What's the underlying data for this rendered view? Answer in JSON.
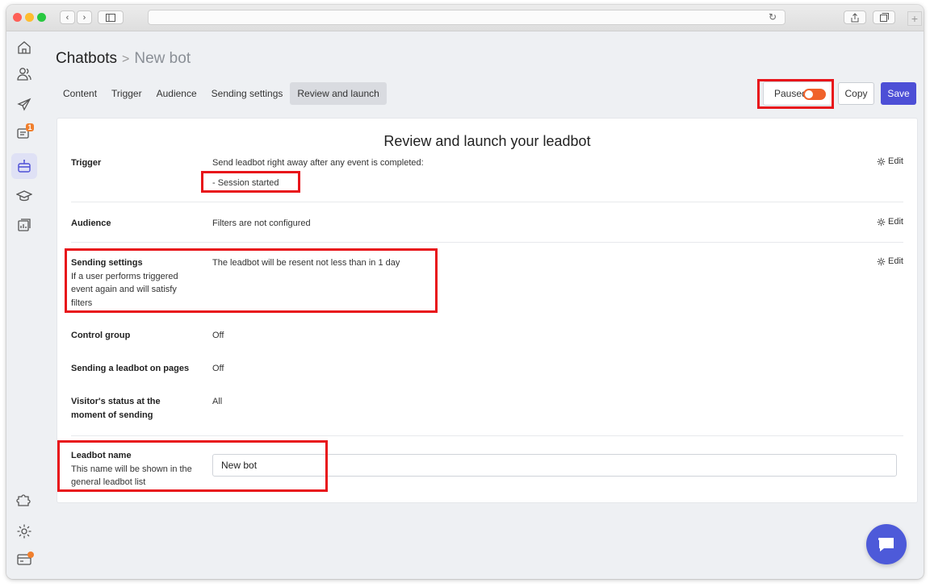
{
  "browser": {
    "nav_back_icon": "chevron-left-icon",
    "nav_forward_icon": "chevron-right-icon",
    "sidebar_toggle_icon": "sidebar-icon",
    "reload_icon": "reload-icon",
    "share_icon": "share-icon",
    "tabs_icon": "tabs-icon",
    "new_tab_label": "+"
  },
  "sidebar": {
    "items": [
      {
        "icon": "home-icon"
      },
      {
        "icon": "users-icon"
      },
      {
        "icon": "send-icon"
      },
      {
        "icon": "chat-icon",
        "badge": "1"
      },
      {
        "icon": "bot-icon",
        "active": true
      },
      {
        "icon": "graduation-cap-icon"
      },
      {
        "icon": "analytics-icon"
      },
      {
        "icon": "puzzle-icon"
      },
      {
        "icon": "settings-icon"
      },
      {
        "icon": "billing-icon",
        "dot": true
      }
    ]
  },
  "breadcrumb": {
    "root": "Chatbots",
    "separator": ">",
    "current": "New bot"
  },
  "tabs": [
    "Content",
    "Trigger",
    "Audience",
    "Sending settings",
    "Review and launch"
  ],
  "active_tab": "Review and launch",
  "status": {
    "paused_label": "Paused",
    "toggle_color": "#f0622b"
  },
  "actions": {
    "copy_label": "Copy",
    "save_label": "Save",
    "save_color": "#4d4fd6"
  },
  "panel": {
    "title": "Review and launch your leadbot",
    "edit_label": "Edit",
    "rows": {
      "trigger": {
        "label": "Trigger",
        "value": "Send leadbot right away after any event is completed:",
        "event": "- Session started"
      },
      "audience": {
        "label": "Audience",
        "value": "Filters are not configured"
      },
      "sending": {
        "label": "Sending settings",
        "sub": "If a user performs triggered event again and will satisfy filters",
        "value": "The leadbot will be resent not less than in 1 day"
      },
      "control_group": {
        "label": "Control group",
        "value": "Off"
      },
      "pages": {
        "label": "Sending a leadbot on pages",
        "value": "Off"
      },
      "visitor_status": {
        "label": "Visitor's status at the moment of sending",
        "value": "All"
      },
      "name": {
        "label": "Leadbot name",
        "sub": "This name will be shown in the general leadbot list",
        "input_value": "New bot"
      }
    }
  },
  "highlight_color": "#e8141a",
  "chat_widget": {
    "icon": "chat-bubble-icon"
  }
}
